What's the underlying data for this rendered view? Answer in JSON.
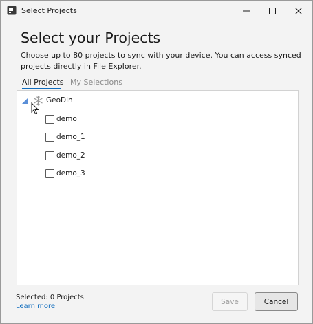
{
  "window": {
    "title": "Select Projects"
  },
  "heading": "Select your Projects",
  "description": "Choose up to 80 projects to sync with your device. You can access synced projects directly in File Explorer.",
  "tabs": [
    {
      "label": "All Projects",
      "selected": true
    },
    {
      "label": "My Selections",
      "selected": false
    }
  ],
  "tree": {
    "root": {
      "label": "GeoDin",
      "icon": "snowflake-icon",
      "expanded": true
    },
    "items": [
      {
        "label": "demo",
        "checked": false
      },
      {
        "label": "demo_1",
        "checked": false
      },
      {
        "label": "demo_2",
        "checked": false
      },
      {
        "label": "demo_3",
        "checked": false
      }
    ]
  },
  "footer": {
    "status": "Selected: 0 Projects",
    "link": "Learn more"
  },
  "buttons": {
    "save": "Save",
    "cancel": "Cancel"
  },
  "colors": {
    "accent": "#0f6cbd",
    "window_bg": "#f3f3f3",
    "panel_bg": "#ffffff",
    "disabled_text": "#a0a0a0"
  }
}
